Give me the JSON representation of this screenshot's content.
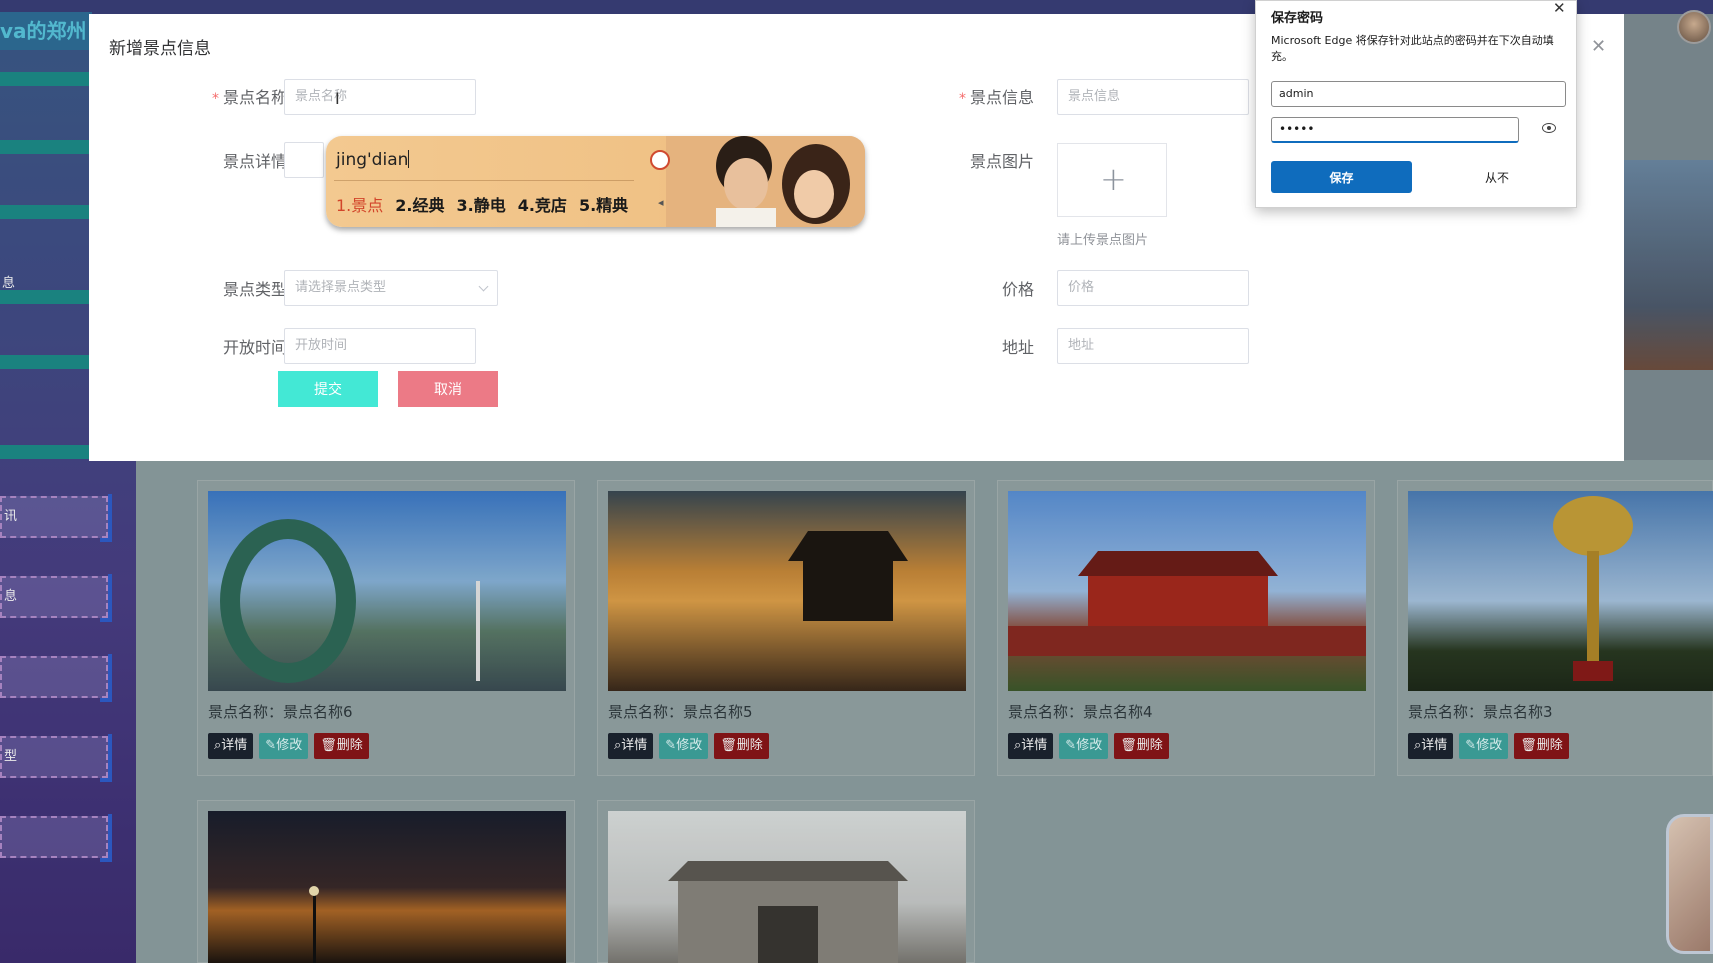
{
  "app": {
    "brand": "va的郑州",
    "sidebar_items": [
      "息",
      "讯",
      "息",
      "",
      "型",
      ""
    ]
  },
  "cards": [
    {
      "label": "景点名称：景点名称6",
      "photo": "green-ring-sculpture"
    },
    {
      "label": "景点名称：景点名称5",
      "photo": "pavilion-sunset"
    },
    {
      "label": "景点名称：景点名称4",
      "photo": "tiananmen-gate"
    },
    {
      "label": "景点名称：景点名称3",
      "photo": "golden-lotus-statue"
    },
    {
      "label": "",
      "photo": "lakeside-night"
    },
    {
      "label": "",
      "photo": "stone-archway"
    }
  ],
  "card_buttons": {
    "detail": "详情",
    "edit": "修改",
    "delete": "删除"
  },
  "dialog": {
    "title": "新增景点信息",
    "fields": {
      "name": {
        "label": "景点名称",
        "placeholder": "景点名称",
        "required": true
      },
      "info": {
        "label": "景点信息",
        "placeholder": "景点信息",
        "required": true
      },
      "detail": {
        "label": "景点详情"
      },
      "image": {
        "label": "景点图片",
        "tip": "请上传景点图片"
      },
      "type": {
        "label": "景点类型",
        "placeholder": "请选择景点类型"
      },
      "price": {
        "label": "价格",
        "placeholder": "价格"
      },
      "open_time": {
        "label": "开放时间",
        "placeholder": "开放时间"
      },
      "address": {
        "label": "地址",
        "placeholder": "地址"
      }
    },
    "submit": "提交",
    "cancel": "取消"
  },
  "ime": {
    "composition": "jing'dian",
    "candidates": [
      "1.景点",
      "2.经典",
      "3.静电",
      "4.竞店",
      "5.精典"
    ]
  },
  "password_popup": {
    "title": "保存密码",
    "description": "Microsoft Edge 将保存针对此站点的密码并在下次自动填充。",
    "username": "admin",
    "password": "•••••",
    "save": "保存",
    "never": "从不"
  },
  "colors": {
    "accent_teal": "#43e8d5",
    "cancel_pink": "#ec7a86",
    "edge_blue": "#0f6cbd",
    "required_red": "#f56c6c"
  }
}
